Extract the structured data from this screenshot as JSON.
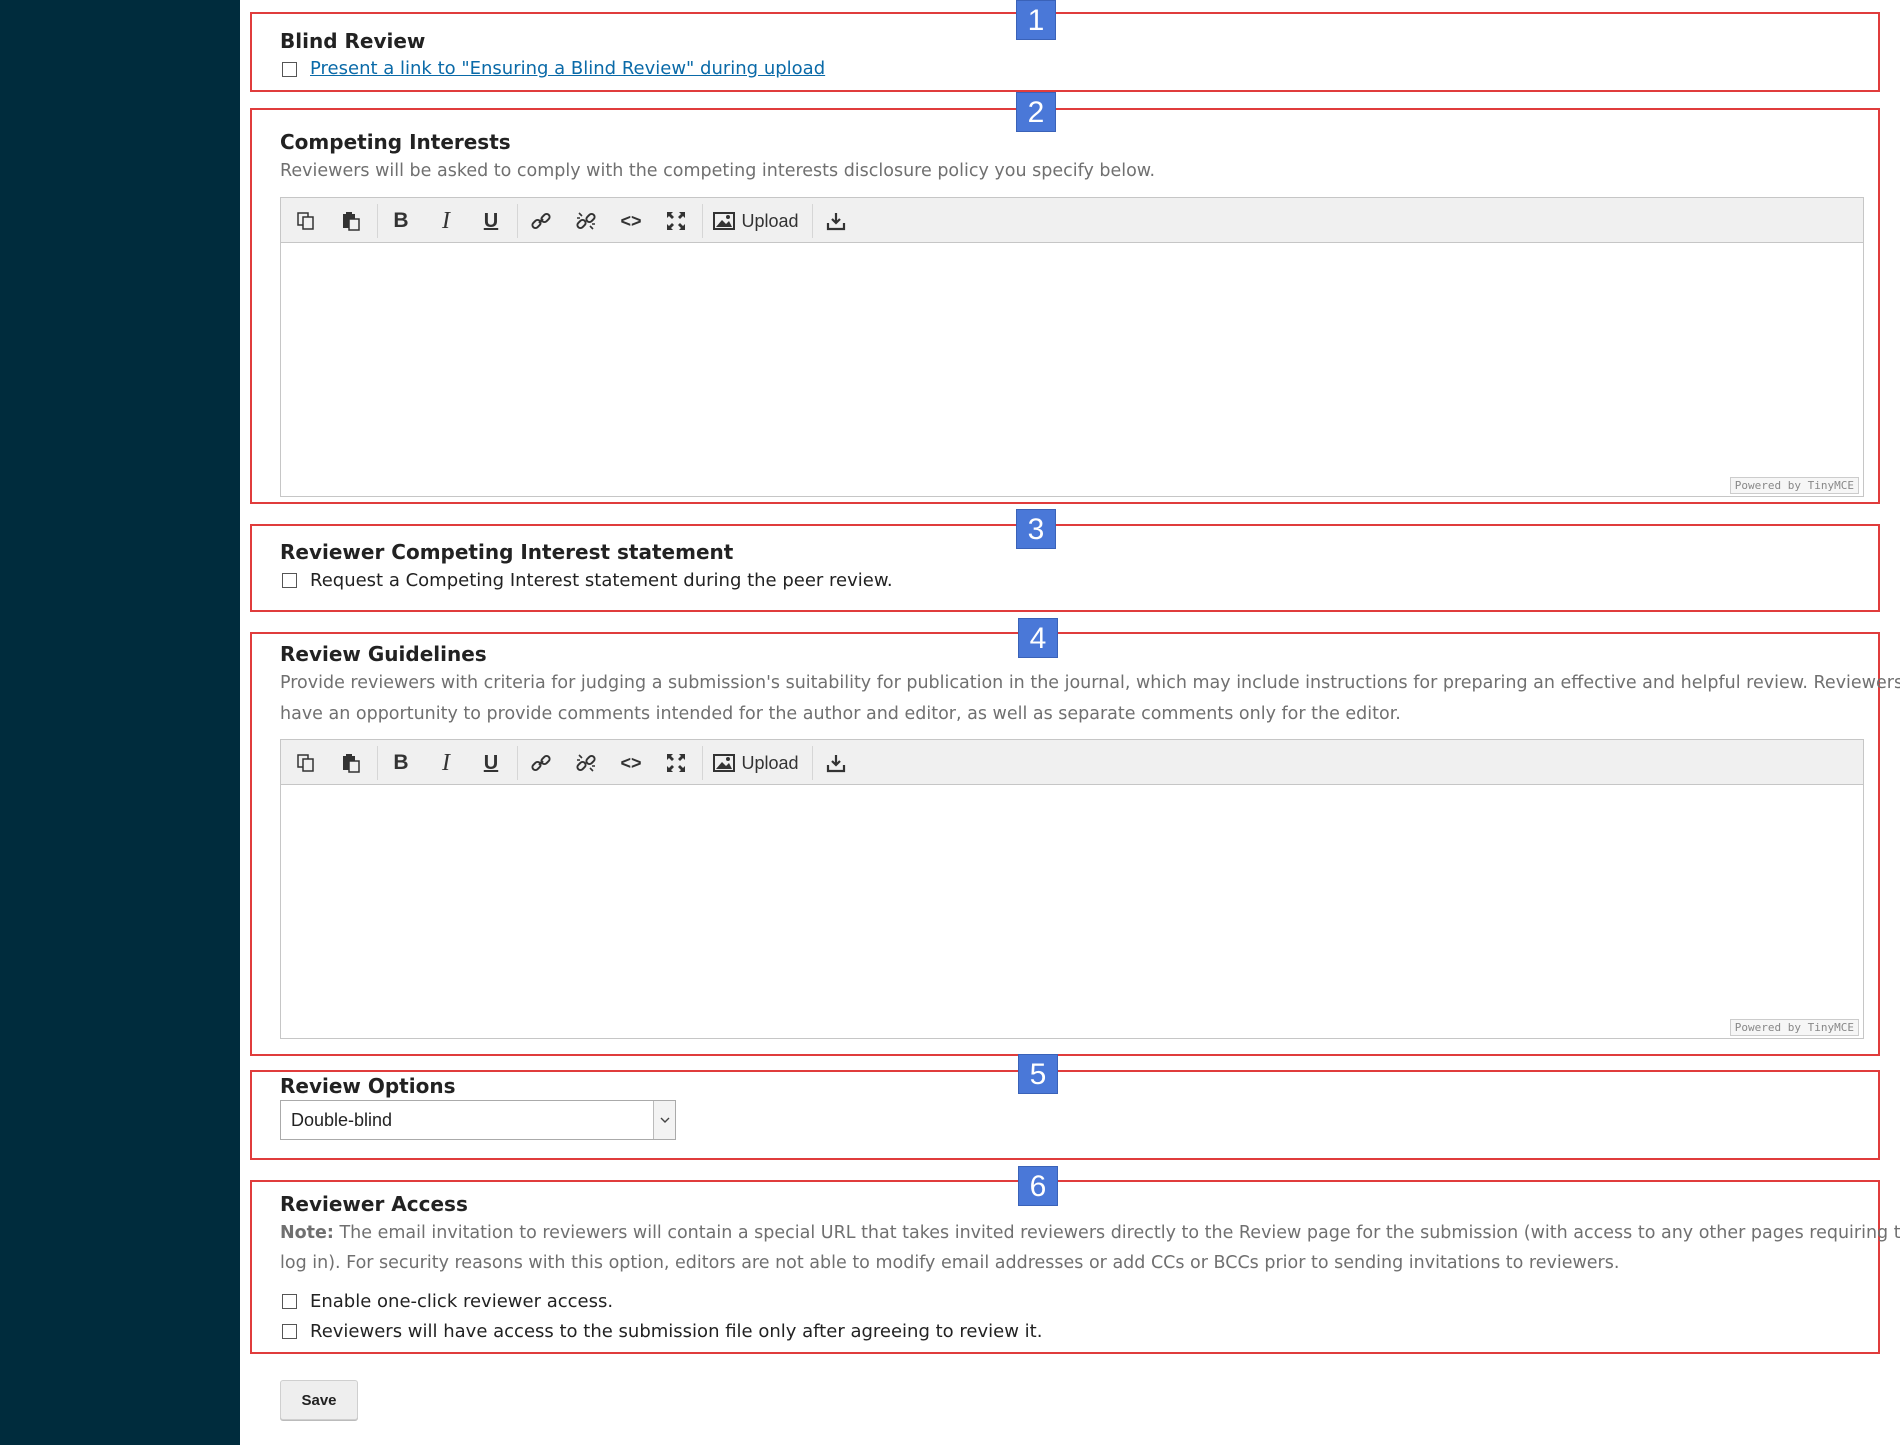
{
  "sections": {
    "blind_review": {
      "badge": "1",
      "title": "Blind Review",
      "checkbox_label": "Present a link to \"Ensuring a Blind Review\" during upload"
    },
    "competing_interests": {
      "badge": "2",
      "title": "Competing Interests",
      "description": "Reviewers will be asked to comply with the competing interests disclosure policy you specify below."
    },
    "reviewer_ci_statement": {
      "badge": "3",
      "title": "Reviewer Competing Interest statement",
      "checkbox_label": "Request a Competing Interest statement during the peer review."
    },
    "review_guidelines": {
      "badge": "4",
      "title": "Review Guidelines",
      "description_line1": "Provide reviewers with criteria for judging a submission's suitability for publication in the journal, which may include instructions for preparing an effective and helpful review. Reviewers will",
      "description_line2": "have an opportunity to provide comments intended for the author and editor, as well as separate comments only for the editor."
    },
    "review_options": {
      "badge": "5",
      "title": "Review Options",
      "selected": "Double-blind"
    },
    "reviewer_access": {
      "badge": "6",
      "title": "Reviewer Access",
      "note_label": "Note:",
      "note_line1": " The email invitation to reviewers will contain a special URL that takes invited reviewers directly to the Review page for the submission (with access to any other pages requiring them to",
      "note_line2": "log in). For security reasons with this option, editors are not able to modify email addresses or add CCs or BCCs prior to sending invitations to reviewers.",
      "checkbox1_label": "Enable one-click reviewer access.",
      "checkbox2_label": "Reviewers will have access to the submission file only after agreeing to review it."
    }
  },
  "editor": {
    "upload_label": "Upload",
    "powered_by": "Powered by TinyMCE",
    "icons": [
      "copy-icon",
      "paste-icon",
      "bold-icon",
      "italic-icon",
      "underline-icon",
      "link-icon",
      "unlink-icon",
      "code-icon",
      "fullscreen-icon",
      "image-icon",
      "download-icon"
    ]
  },
  "actions": {
    "save_label": "Save"
  },
  "colors": {
    "sidebar": "#002c3d",
    "highlight_border": "#e03c3c",
    "badge": "#4a78d8",
    "link": "#0a6aa8"
  }
}
